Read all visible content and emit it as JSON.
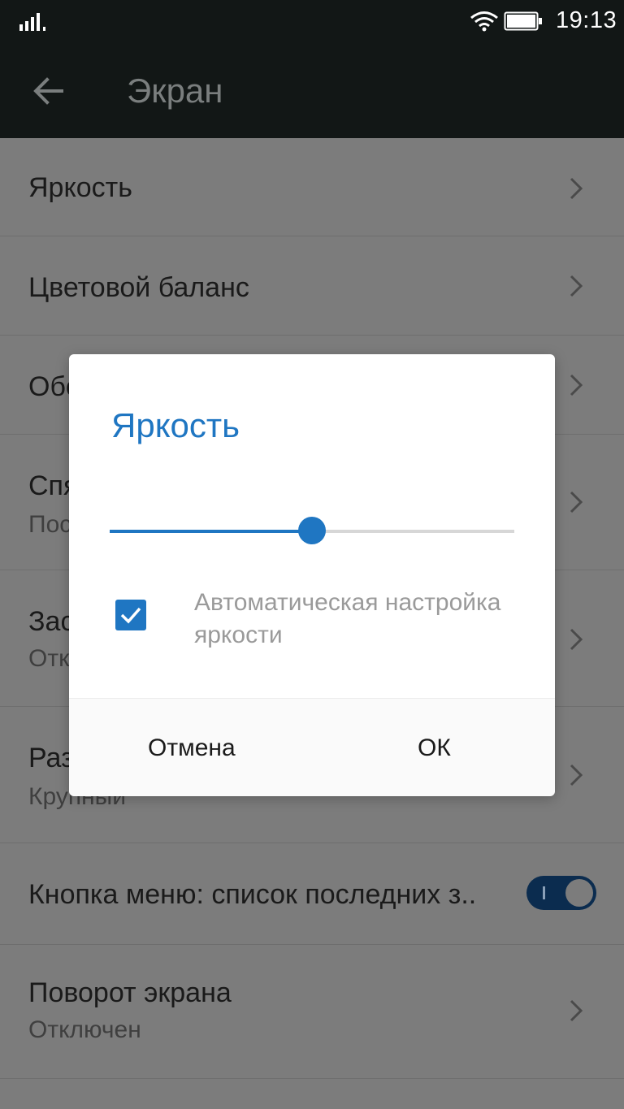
{
  "status_bar": {
    "time": "19:13"
  },
  "app_bar": {
    "title": "Экран"
  },
  "settings": {
    "brightness": {
      "title": "Яркость"
    },
    "color_balance": {
      "title": "Цветовой баланс"
    },
    "row3": {
      "title": "Обо"
    },
    "row4": {
      "title": "Спя",
      "subtitle": "Пос"
    },
    "row5": {
      "title": "Зас",
      "subtitle": "Отк"
    },
    "row6": {
      "title": "Раз",
      "subtitle": "Крупный"
    },
    "menu_button": {
      "title": "Кнопка меню: список последних з..",
      "toggle_on": true
    },
    "rotation": {
      "title": "Поворот экрана",
      "subtitle": "Отключен"
    }
  },
  "dialog": {
    "title": "Яркость",
    "slider_value": 0.5,
    "auto_checked": true,
    "auto_label": "Автоматическая настройка яркости",
    "cancel_label": "Отмена",
    "ok_label": "ОК"
  },
  "colors": {
    "accent": "#1f76c2",
    "bar_background": "#121716",
    "scrim": "#7c7c7c"
  }
}
